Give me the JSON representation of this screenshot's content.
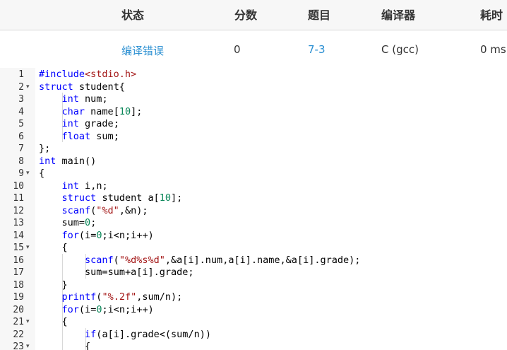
{
  "table": {
    "headers": [
      "状态",
      "分数",
      "题目",
      "编译器",
      "耗时"
    ],
    "row": {
      "status": "编译错误",
      "score": "0",
      "problem": "7-3",
      "compiler": "C (gcc)",
      "time": "0 ms"
    }
  },
  "editor": {
    "lines": [
      {
        "n": "1",
        "text": "#include<stdio.h>"
      },
      {
        "n": "2",
        "text": "struct student{",
        "fold": true
      },
      {
        "n": "3",
        "text": "    int num;"
      },
      {
        "n": "4",
        "text": "    char name[10];"
      },
      {
        "n": "5",
        "text": "    int grade;"
      },
      {
        "n": "6",
        "text": "    float sum;"
      },
      {
        "n": "7",
        "text": "};"
      },
      {
        "n": "8",
        "text": "int main()"
      },
      {
        "n": "9",
        "text": "{",
        "fold": true
      },
      {
        "n": "10",
        "text": "    int i,n;"
      },
      {
        "n": "11",
        "text": "    struct student a[10];"
      },
      {
        "n": "12",
        "text": "    scanf(\"%d\",&n);"
      },
      {
        "n": "13",
        "text": "    sum=0;"
      },
      {
        "n": "14",
        "text": "    for(i=0;i<n;i++)"
      },
      {
        "n": "15",
        "text": "    {",
        "fold": true
      },
      {
        "n": "16",
        "text": "        scanf(\"%d%s%d\",&a[i].num,a[i].name,&a[i].grade);"
      },
      {
        "n": "17",
        "text": "        sum=sum+a[i].grade;"
      },
      {
        "n": "18",
        "text": "    }"
      },
      {
        "n": "19",
        "text": "    printf(\"%.2f\",sum/n);"
      },
      {
        "n": "20",
        "text": "    for(i=0;i<n;i++)"
      },
      {
        "n": "21",
        "text": "    {",
        "fold": true
      },
      {
        "n": "22",
        "text": "        if(a[i].grade<(sum/n))"
      },
      {
        "n": "23",
        "text": "        {",
        "fold": true
      }
    ],
    "fold_icon": "chevron-down-icon"
  },
  "colors": {
    "link": "#2a8fd2",
    "keyword": "#0000ff",
    "string": "#a31515",
    "number": "#098658",
    "gutter": "#f7f7f7",
    "header_bg": "#f7f7f7"
  }
}
